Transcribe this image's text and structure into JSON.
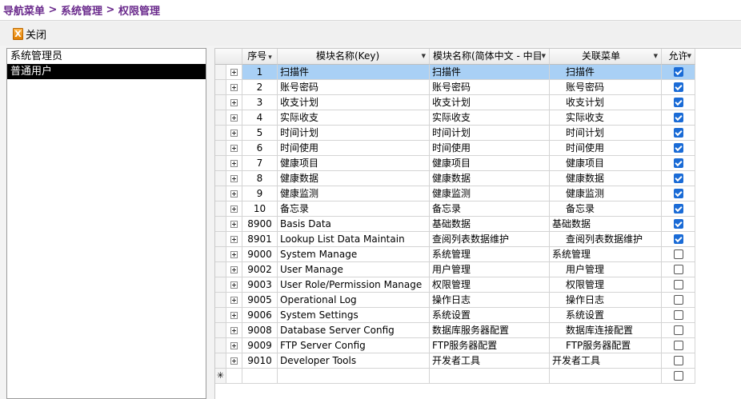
{
  "breadcrumb": [
    "导航菜单",
    " > ",
    "系统管理",
    " > ",
    "权限管理"
  ],
  "toolbar": {
    "close_label": "关闭",
    "close_icon": "close-icon"
  },
  "roles": [
    {
      "label": "系统管理员",
      "selected": false
    },
    {
      "label": "普通用户",
      "selected": true
    }
  ],
  "grid": {
    "headers": {
      "seq": "序号",
      "seq_sort_glyph": "▾",
      "key": "模块名称(Key)",
      "cn": "模块名称(简体中文 - 中目",
      "menu": "关联菜单",
      "allow": "允许",
      "filter_glyph": "▼"
    },
    "new_row_glyph": "✳",
    "rows": [
      {
        "seq": "1",
        "key": "扫描件",
        "cn": "扫描件",
        "menu": "扫描件",
        "indent": true,
        "allowed": true,
        "selected": true
      },
      {
        "seq": "2",
        "key": "账号密码",
        "cn": "账号密码",
        "menu": "账号密码",
        "indent": true,
        "allowed": true
      },
      {
        "seq": "3",
        "key": "收支计划",
        "cn": "收支计划",
        "menu": "收支计划",
        "indent": true,
        "allowed": true
      },
      {
        "seq": "4",
        "key": "实际收支",
        "cn": "实际收支",
        "menu": "实际收支",
        "indent": true,
        "allowed": true
      },
      {
        "seq": "5",
        "key": "时间计划",
        "cn": "时间计划",
        "menu": "时间计划",
        "indent": true,
        "allowed": true
      },
      {
        "seq": "6",
        "key": "时间使用",
        "cn": "时间使用",
        "menu": "时间使用",
        "indent": true,
        "allowed": true
      },
      {
        "seq": "7",
        "key": "健康项目",
        "cn": "健康项目",
        "menu": "健康项目",
        "indent": true,
        "allowed": true
      },
      {
        "seq": "8",
        "key": "健康数据",
        "cn": "健康数据",
        "menu": "健康数据",
        "indent": true,
        "allowed": true
      },
      {
        "seq": "9",
        "key": "健康监测",
        "cn": "健康监测",
        "menu": "健康监测",
        "indent": true,
        "allowed": true
      },
      {
        "seq": "10",
        "key": "备忘录",
        "cn": "备忘录",
        "menu": "备忘录",
        "indent": true,
        "allowed": true
      },
      {
        "seq": "8900",
        "key": "Basis Data",
        "cn": "基础数据",
        "menu": "基础数据",
        "indent": false,
        "allowed": true
      },
      {
        "seq": "8901",
        "key": "Lookup List Data Maintain",
        "cn": "查阅列表数据维护",
        "menu": "查阅列表数据维护",
        "indent": true,
        "allowed": true
      },
      {
        "seq": "9000",
        "key": "System Manage",
        "cn": "系统管理",
        "menu": "系统管理",
        "indent": false,
        "allowed": false
      },
      {
        "seq": "9002",
        "key": "User Manage",
        "cn": "用户管理",
        "menu": "用户管理",
        "indent": true,
        "allowed": false
      },
      {
        "seq": "9003",
        "key": "User Role/Permission Manage",
        "cn": "权限管理",
        "menu": "权限管理",
        "indent": true,
        "allowed": false
      },
      {
        "seq": "9005",
        "key": "Operational Log",
        "cn": "操作日志",
        "menu": "操作日志",
        "indent": true,
        "allowed": false
      },
      {
        "seq": "9006",
        "key": "System Settings",
        "cn": "系统设置",
        "menu": "系统设置",
        "indent": true,
        "allowed": false
      },
      {
        "seq": "9008",
        "key": "Database Server Config",
        "cn": "数据库服务器配置",
        "menu": "数据库连接配置",
        "indent": true,
        "allowed": false
      },
      {
        "seq": "9009",
        "key": "FTP Server Config",
        "cn": "FTP服务器配置",
        "menu": "FTP服务器配置",
        "indent": true,
        "allowed": false
      },
      {
        "seq": "9010",
        "key": "Developer Tools",
        "cn": "开发者工具",
        "menu": "开发者工具",
        "indent": false,
        "allowed": false
      }
    ]
  },
  "colors": {
    "breadcrumb_text": "#6a2a8c",
    "selected_row": "#a9d0f5",
    "checkbox_on": "#1a6bd6",
    "selected_role": "#000000"
  }
}
